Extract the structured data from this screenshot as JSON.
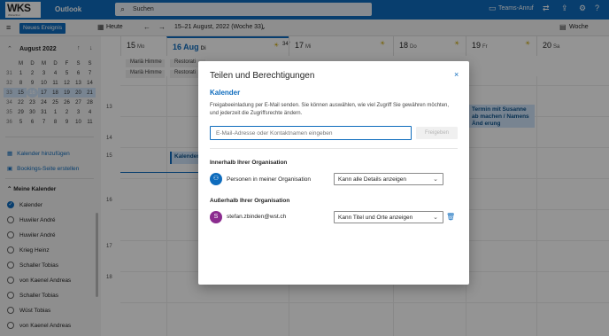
{
  "app": {
    "logo_text": "WKS",
    "logo_sub": "Winterthur",
    "name": "Outlook"
  },
  "search": {
    "placeholder": "Suchen"
  },
  "topright": {
    "teams_label": "Teams-Anruf"
  },
  "commandbar": {
    "new_event": "Neues Ereignis",
    "today": "Heute",
    "range": "15–21 August, 2022 (Woche 33)",
    "view": "Woche"
  },
  "minical": {
    "title": "August 2022",
    "weekdays": [
      "M",
      "D",
      "M",
      "D",
      "F",
      "S",
      "S"
    ],
    "rows": [
      {
        "wk": "31",
        "days": [
          "1",
          "2",
          "3",
          "4",
          "5",
          "6",
          "7"
        ]
      },
      {
        "wk": "32",
        "days": [
          "8",
          "9",
          "10",
          "11",
          "12",
          "13",
          "14"
        ]
      },
      {
        "wk": "33",
        "days": [
          "15",
          "16",
          "17",
          "18",
          "19",
          "20",
          "21"
        ]
      },
      {
        "wk": "34",
        "days": [
          "22",
          "23",
          "24",
          "25",
          "26",
          "27",
          "28"
        ]
      },
      {
        "wk": "35",
        "days": [
          "29",
          "30",
          "31",
          "1",
          "2",
          "3",
          "4"
        ]
      },
      {
        "wk": "36",
        "days": [
          "5",
          "6",
          "7",
          "8",
          "9",
          "10",
          "11"
        ]
      }
    ],
    "today": "16"
  },
  "sidebar": {
    "add_calendar": "Kalender hinzufügen",
    "bookings": "Bookings-Seite erstellen",
    "my_calendars": "Meine Kalender",
    "calendars": [
      "Kalender",
      "Huwiler André",
      "Huwiler André",
      "Krieg Heinz",
      "Schaller Tobias",
      "von Kaenel Andreas",
      "Schaller Tobias",
      "Wüst Tobias",
      "von Kaenel Andreas"
    ]
  },
  "week": {
    "days": [
      {
        "num": "15",
        "name": "Mo"
      },
      {
        "num": "16 Aug",
        "name": "Di"
      },
      {
        "num": "17",
        "name": "Mi"
      },
      {
        "num": "18",
        "name": "Do"
      },
      {
        "num": "19",
        "name": "Fr"
      },
      {
        "num": "20",
        "name": "Sa"
      }
    ],
    "temp": "34°",
    "allday": [
      "Mariä Himme",
      "Mariä Himme",
      "Restorati",
      "Restorati"
    ],
    "hours": [
      "13",
      "14",
      "15",
      "16",
      "17",
      "18"
    ],
    "events": [
      "Kalender-",
      "Termin mit Susanne ab machen / Namens Änd erung"
    ]
  },
  "dialog": {
    "title": "Teilen und Berechtigungen",
    "close": "×",
    "subtitle": "Kalender",
    "description": "Freigabeeinladung per E-Mail senden. Sie können auswählen, wie viel Zugriff Sie gewähren möchten, und jederzeit die Zugriffsrechte ändern.",
    "input_placeholder": "E-Mail-Adresse oder Kontaktnamen eingeben",
    "share_button": "Freigeben",
    "inside_title": "Innerhalb Ihrer Organisation",
    "inside_person": "Personen in meiner Organisation",
    "inside_perm": "Kann alle Details anzeigen",
    "outside_title": "Außerhalb Ihrer Organisation",
    "outside_initial": "S",
    "outside_person": "stefan.zbinden@wst.ch",
    "outside_perm": "Kann Titel und Orte anzeigen"
  },
  "colors": {
    "accent": "#0f6cbd",
    "avatar_s": "#8b2c8f"
  }
}
